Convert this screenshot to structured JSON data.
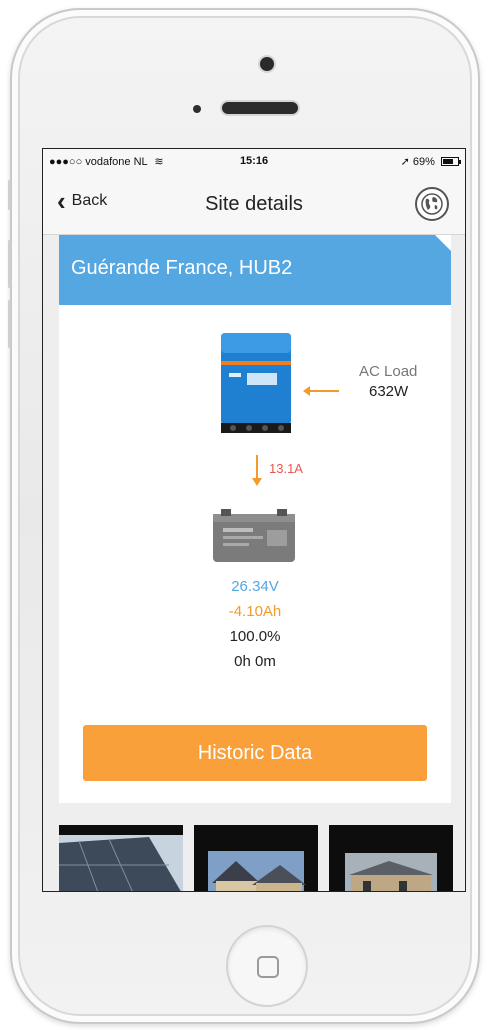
{
  "status_bar": {
    "carrier": "●●●○○ vodafone NL",
    "wifi_icon": "wifi-icon",
    "time": "15:16",
    "location_icon": "location-arrow-icon",
    "battery_percent": "69%",
    "battery_level": 0.69
  },
  "nav": {
    "back_label": "Back",
    "title": "Site details",
    "globe_icon": "globe-icon"
  },
  "site": {
    "name": "Guérande France, HUB2",
    "header_color": "#55a7e2"
  },
  "system": {
    "ac_load_label": "AC Load",
    "ac_load_value": "632W",
    "dc_current": "13.1A"
  },
  "battery": {
    "voltage": "26.34V",
    "consumed": "-4.10Ah",
    "soc": "100.0%",
    "time_to_go": "0h 0m"
  },
  "actions": {
    "historic_label": "Historic Data",
    "button_color": "#f9a03a"
  },
  "colors": {
    "accent_blue": "#55a7e2",
    "accent_orange": "#f39a2a",
    "current_red": "#e9584d"
  }
}
